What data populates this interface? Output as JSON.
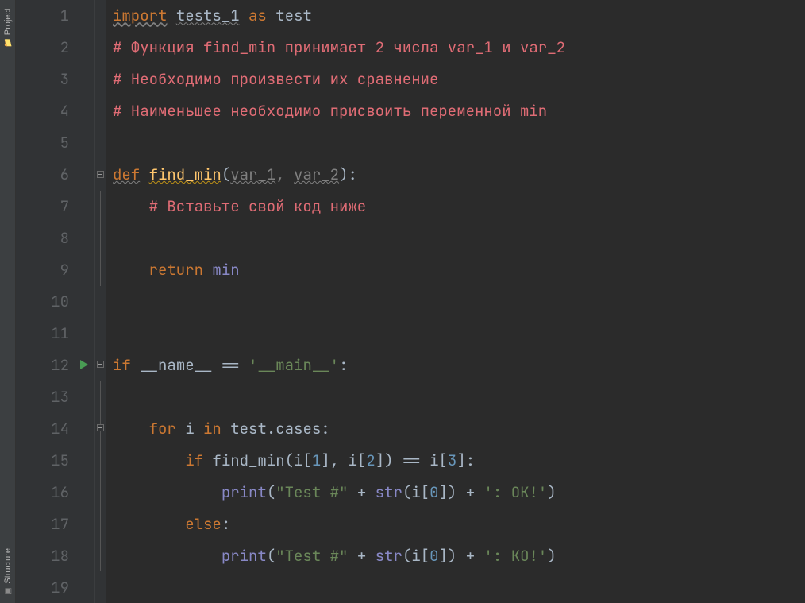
{
  "sideTabs": {
    "top": {
      "label": "Project"
    },
    "bottom": {
      "label": "Structure"
    }
  },
  "lines": [
    1,
    2,
    3,
    4,
    5,
    6,
    7,
    8,
    9,
    10,
    11,
    12,
    13,
    14,
    15,
    16,
    17,
    18,
    19
  ],
  "runLine": 12,
  "code": {
    "l1": {
      "kw_import": "import",
      "module": "tests_1",
      "kw_as": "as",
      "alias": "test"
    },
    "l2": {
      "comment": "# Функция find_min принимает 2 числа var_1 и var_2"
    },
    "l3": {
      "comment": "# Необходимо произвести их сравнение"
    },
    "l4": {
      "comment": "# Наименьшее необходимо присвоить переменной min"
    },
    "l6": {
      "kw_def": "def",
      "name": "find_min",
      "p1": "var_1",
      "p2": "var_2"
    },
    "l7": {
      "comment": "# Вставьте свой код ниже"
    },
    "l9": {
      "kw_return": "return",
      "val": "min"
    },
    "l12": {
      "kw_if": "if",
      "dunder": "__name__",
      "eq": "==",
      "str": "'__main__'"
    },
    "l14": {
      "kw_for": "for",
      "var": "i",
      "kw_in": "in",
      "iter": "test.cases"
    },
    "l15": {
      "kw_if": "if",
      "fn": "find_min",
      "a1_pre": "i[",
      "a1_idx": "1",
      "a1_post": "]",
      "a2_pre": "i[",
      "a2_idx": "2",
      "a2_post": "]",
      "eq": "==",
      "r_pre": "i[",
      "r_idx": "3",
      "r_post": "]"
    },
    "l16": {
      "fn": "print",
      "s1": "\"Test #\"",
      "plus": "+",
      "str_fn": "str",
      "arg_pre": "i[",
      "arg_idx": "0",
      "arg_post": "]",
      "s2": "': OK!'"
    },
    "l17": {
      "kw_else": "else"
    },
    "l18": {
      "fn": "print",
      "s1": "\"Test #\"",
      "plus": "+",
      "str_fn": "str",
      "arg_pre": "i[",
      "arg_idx": "0",
      "arg_post": "]",
      "s2": "': KO!'"
    }
  }
}
